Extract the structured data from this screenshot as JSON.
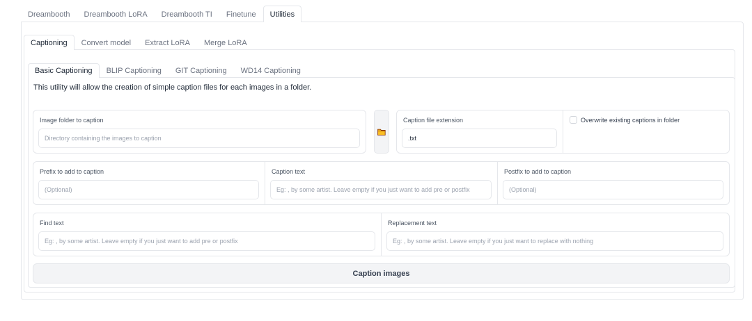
{
  "main_tabs": [
    "Dreambooth",
    "Dreambooth LoRA",
    "Dreambooth TI",
    "Finetune",
    "Utilities"
  ],
  "utility_tabs": [
    "Captioning",
    "Convert model",
    "Extract LoRA",
    "Merge LoRA"
  ],
  "caption_tabs": [
    "Basic Captioning",
    "BLIP Captioning",
    "GIT Captioning",
    "WD14 Captioning"
  ],
  "description": "This utility will allow the creation of simple caption files for each images in a folder.",
  "image_folder": {
    "label": "Image folder to caption",
    "placeholder": "Directory containing the images to caption"
  },
  "folder_icon": "folder-icon",
  "caption_ext": {
    "label": "Caption file extension",
    "value": ".txt"
  },
  "overwrite": {
    "label": "Overwrite existing captions in folder",
    "checked": false
  },
  "prefix": {
    "label": "Prefix to add to caption",
    "placeholder": "(Optional)"
  },
  "caption_text": {
    "label": "Caption text",
    "placeholder": "Eg: , by some artist. Leave empty if you just want to add pre or postfix"
  },
  "postfix": {
    "label": "Postfix to add to caption",
    "placeholder": "(Optional)"
  },
  "find_text": {
    "label": "Find text",
    "placeholder": "Eg: , by some artist. Leave empty if you just want to add pre or postfix"
  },
  "replacement_text": {
    "label": "Replacement text",
    "placeholder": "Eg: , by some artist. Leave empty if you just want to replace with nothing"
  },
  "caption_button": "Caption images"
}
